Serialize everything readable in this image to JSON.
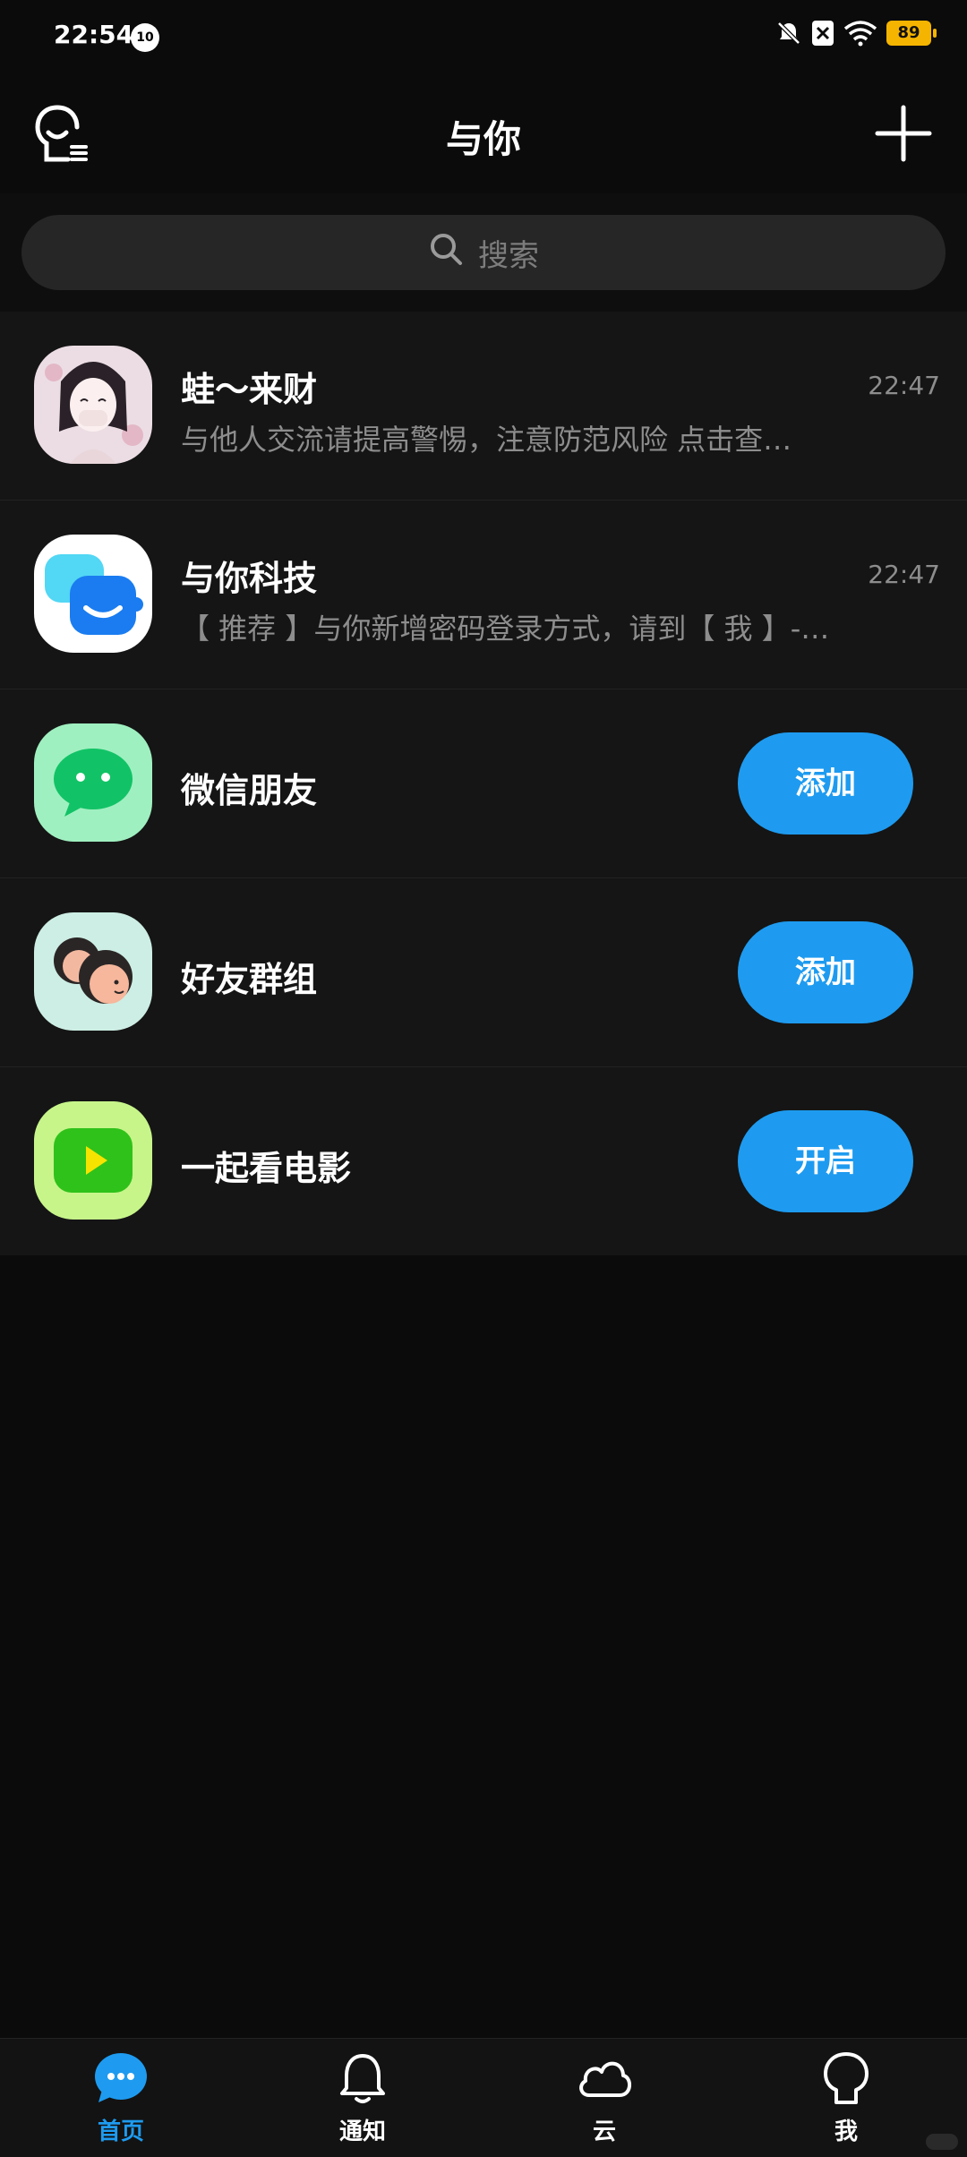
{
  "status_bar": {
    "time": "22:54",
    "notification_badge": "10",
    "battery": "89",
    "icons": [
      "mute-bell-icon",
      "close-box-icon",
      "wifi-icon",
      "battery-icon"
    ],
    "battery_color": "#f5b400"
  },
  "header": {
    "title": "与你",
    "left_icon": "profile-list-icon",
    "right_icon": "plus-icon"
  },
  "search": {
    "placeholder": "搜索",
    "icon": "search-icon"
  },
  "conversations": [
    {
      "title": "蛙～来财",
      "subtitle": "与他人交流请提高警惕，注意防范风险 点击查…",
      "time": "22:47",
      "avatar": "anime-girl-avatar"
    },
    {
      "title": "与你科技",
      "subtitle": "【 推荐 】与你新增密码登录方式，请到【 我 】-…",
      "time": "22:47",
      "avatar": "chat-bubbles-app-icon"
    }
  ],
  "features": [
    {
      "title": "微信朋友",
      "button": "添加",
      "avatar": "wechat-icon"
    },
    {
      "title": "好友群组",
      "button": "添加",
      "avatar": "friends-group-icon"
    },
    {
      "title": "一起看电影",
      "button": "开启",
      "avatar": "play-movie-icon"
    }
  ],
  "bottom_nav": [
    {
      "label": "首页",
      "icon": "chat-home-icon",
      "active": true
    },
    {
      "label": "通知",
      "icon": "bell-icon",
      "active": false
    },
    {
      "label": "云",
      "icon": "cloud-icon",
      "active": false
    },
    {
      "label": "我",
      "icon": "profile-icon",
      "active": false
    }
  ],
  "colors": {
    "accent": "#1e9bf0",
    "background": "#0b0b0b",
    "list_background": "#151515"
  }
}
